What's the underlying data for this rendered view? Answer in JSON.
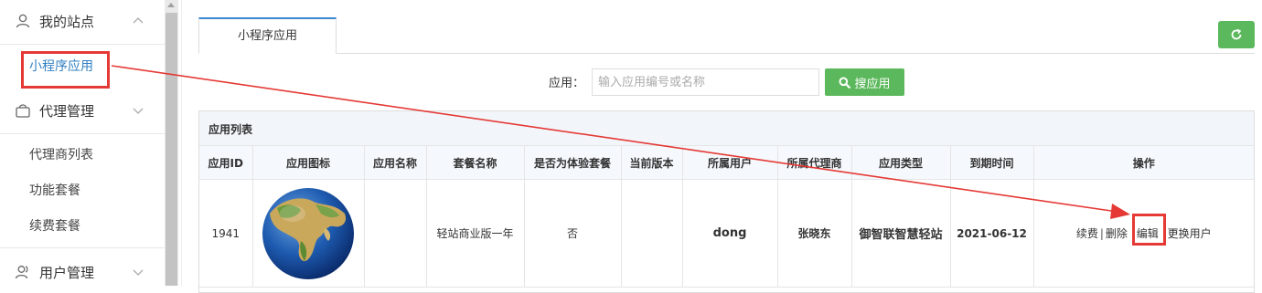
{
  "sidebar": {
    "groups": [
      {
        "label": "我的站点",
        "icon": "user-icon",
        "expanded": true,
        "items": [
          {
            "label": "小程序应用",
            "active": true
          }
        ]
      },
      {
        "label": "代理管理",
        "icon": "shopping-bag-icon",
        "expanded": true,
        "items": [
          {
            "label": "代理商列表"
          },
          {
            "label": "功能套餐"
          },
          {
            "label": "续费套餐"
          }
        ]
      },
      {
        "label": "用户管理",
        "icon": "users-icon",
        "expanded": false
      }
    ]
  },
  "tabs": [
    {
      "label": "小程序应用",
      "active": true
    }
  ],
  "search": {
    "label": "应用：",
    "placeholder": "输入应用编号或名称",
    "value": "",
    "button_label": "搜应用"
  },
  "panel": {
    "title": "应用列表"
  },
  "table": {
    "columns": [
      "应用ID",
      "应用图标",
      "应用名称",
      "套餐名称",
      "是否为体验套餐",
      "当前版本",
      "所属用户",
      "所属代理商",
      "应用类型",
      "到期时间",
      "操作"
    ],
    "rows": [
      {
        "id": "1941",
        "icon": "globe-icon",
        "name": "",
        "package": "轻站商业版一年",
        "is_trial": "否",
        "version": "",
        "user": "dong",
        "agent": "张晓东",
        "type": "御智联智慧轻站",
        "expires": "2021-06-12",
        "actions": {
          "renew": "续费",
          "sep": "|",
          "delete": "删除",
          "edit": "编辑",
          "change_user": "更换用户"
        }
      }
    ]
  },
  "colors": {
    "accent_blue": "#3a86cf",
    "button_green": "#5cb85c",
    "annotation_red": "#e53935"
  }
}
